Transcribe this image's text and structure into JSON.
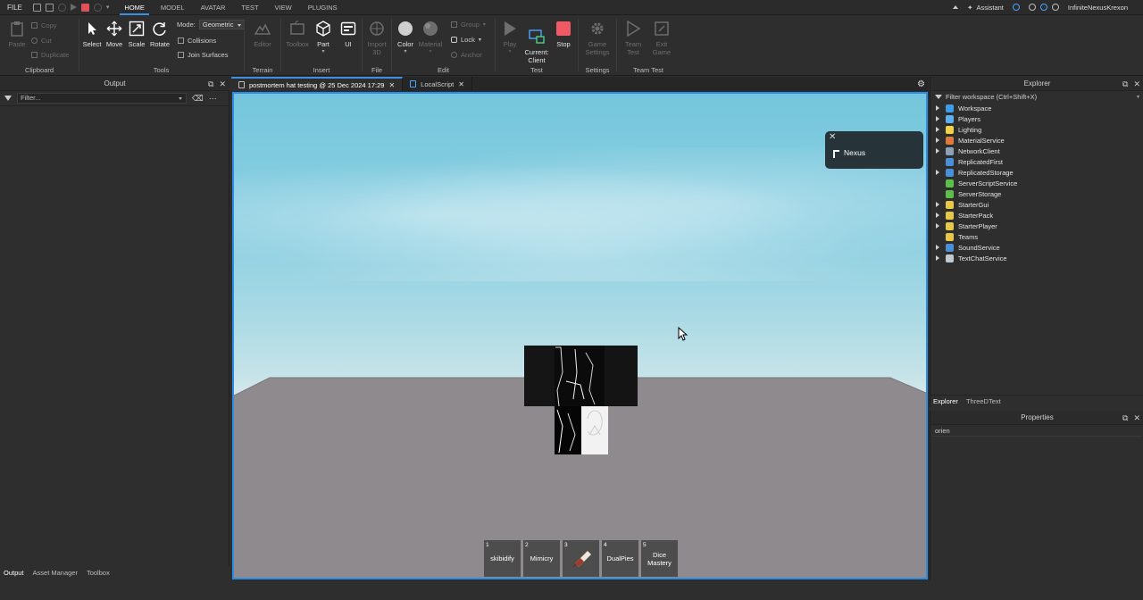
{
  "menubar": {
    "file": "FILE",
    "tabs": [
      "HOME",
      "MODEL",
      "AVATAR",
      "TEST",
      "VIEW",
      "PLUGINS"
    ],
    "active_tab": "HOME",
    "assistant": "Assistant",
    "username": "InfiniteNexusKrexon"
  },
  "ribbon": {
    "clipboard": {
      "label": "Clipboard",
      "paste": "Paste",
      "copy": "Copy",
      "cut": "Cut",
      "duplicate": "Duplicate"
    },
    "tools": {
      "label": "Tools",
      "select": "Select",
      "move": "Move",
      "scale": "Scale",
      "rotate": "Rotate",
      "mode_label": "Mode:",
      "mode_value": "Geometric",
      "collisions": "Collisions",
      "join_surfaces": "Join Surfaces"
    },
    "terrain": {
      "label": "Terrain",
      "editor": "Editor"
    },
    "insert": {
      "label": "Insert",
      "toolbox": "Toolbox",
      "part": "Part",
      "ui": "UI"
    },
    "file": {
      "label": "File",
      "import3d": "Import 3D"
    },
    "edit": {
      "label": "Edit",
      "color": "Color",
      "material": "Material",
      "group": "Group",
      "lock": "Lock",
      "anchor": "Anchor"
    },
    "test": {
      "label": "Test",
      "play": "Play",
      "current_client": "Current:\nClient",
      "stop": "Stop"
    },
    "settings": {
      "label": "Settings",
      "game_settings": "Game Settings"
    },
    "team_test": {
      "label": "Team Test",
      "team_test": "Team Test",
      "exit_game": "Exit Game"
    }
  },
  "output": {
    "title": "Output",
    "filter_placeholder": "Filter..."
  },
  "bottom_tabs": [
    "Output",
    "Asset Manager",
    "Toolbox"
  ],
  "doc_tabs": [
    {
      "label": "postmortem hat testing @ 25 Dec 2024 17:29"
    },
    {
      "label": "LocalScript"
    }
  ],
  "viewport": {
    "notification": "Nexus",
    "hotbar": [
      {
        "num": "1",
        "label": "skibidify"
      },
      {
        "num": "2",
        "label": "Mimicry"
      },
      {
        "num": "3",
        "label": ""
      },
      {
        "num": "4",
        "label": "DualPies"
      },
      {
        "num": "5",
        "label": "Dice Mastery"
      }
    ]
  },
  "explorer": {
    "title": "Explorer",
    "filter": "Filter workspace (Ctrl+Shift+X)",
    "items": [
      {
        "label": "Workspace",
        "expandable": true,
        "color": "#3d9be9"
      },
      {
        "label": "Players",
        "expandable": true,
        "color": "#5ab0f0"
      },
      {
        "label": "Lighting",
        "expandable": true,
        "color": "#f2d24a"
      },
      {
        "label": "MaterialService",
        "expandable": true,
        "color": "#e07a3a"
      },
      {
        "label": "NetworkClient",
        "expandable": true,
        "color": "#8ea0b8"
      },
      {
        "label": "ReplicatedFirst",
        "expandable": false,
        "color": "#4a90d9"
      },
      {
        "label": "ReplicatedStorage",
        "expandable": true,
        "color": "#4a90d9"
      },
      {
        "label": "ServerScriptService",
        "expandable": false,
        "color": "#5cbf4a"
      },
      {
        "label": "ServerStorage",
        "expandable": false,
        "color": "#5cbf4a"
      },
      {
        "label": "StarterGui",
        "expandable": true,
        "color": "#e8c84a"
      },
      {
        "label": "StarterPack",
        "expandable": true,
        "color": "#e8c84a"
      },
      {
        "label": "StarterPlayer",
        "expandable": true,
        "color": "#e8c84a"
      },
      {
        "label": "Teams",
        "expandable": false,
        "color": "#e8c84a"
      },
      {
        "label": "SoundService",
        "expandable": true,
        "color": "#4a90d9"
      },
      {
        "label": "TextChatService",
        "expandable": true,
        "color": "#c0c8d0"
      }
    ],
    "tabs": [
      "Explorer",
      "ThreeDText"
    ]
  },
  "properties": {
    "title": "Properties",
    "filter_value": "orien"
  }
}
